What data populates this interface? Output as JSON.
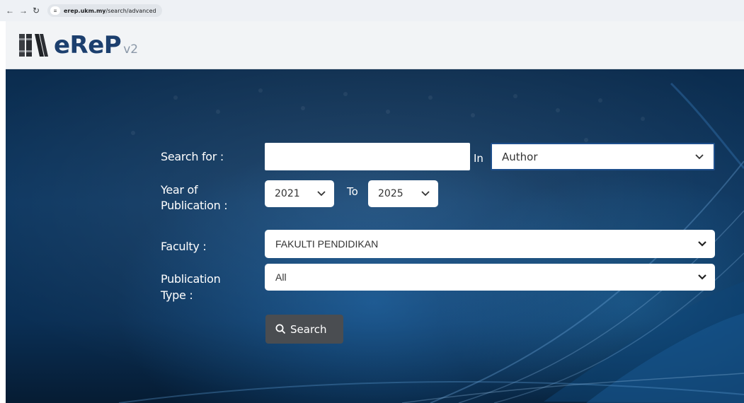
{
  "browser": {
    "url_host": "erep.ukm.my",
    "url_path": "/search/advanced"
  },
  "header": {
    "logo_text": "eReP",
    "logo_version": "v2"
  },
  "form": {
    "search_for_label": "Search for :",
    "search_value": "",
    "in_label": "In",
    "in_field_selected": "Author",
    "year_label_line1": "Year of",
    "year_label_line2": "Publication :",
    "year_from": "2021",
    "to_label": "To",
    "year_to": "2025",
    "faculty_label": "Faculty :",
    "faculty_selected": "FAKULTI PENDIDIKAN",
    "pubtype_label_line1": "Publication",
    "pubtype_label_line2": "Type :",
    "pubtype_selected": "All",
    "search_button_label": "Search"
  },
  "colors": {
    "brand": "#1c3f6e",
    "hero_dark": "#0b2c4e",
    "button": "#4a4d51"
  },
  "icons": {
    "back": "arrow-left-icon",
    "forward": "arrow-right-icon",
    "reload": "reload-icon",
    "site_info": "tune-icon",
    "search": "magnifier-icon",
    "dropdown": "chevron-down-icon",
    "logo": "books-icon"
  }
}
